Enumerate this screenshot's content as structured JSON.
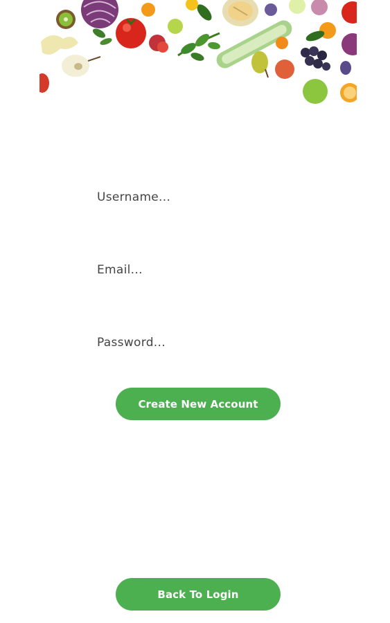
{
  "form": {
    "username_placeholder": "Username...",
    "email_placeholder": "Email...",
    "password_placeholder": "Password...",
    "username_value": "",
    "email_value": "",
    "password_value": ""
  },
  "buttons": {
    "create_label": "Create New Account",
    "back_label": "Back To Login"
  },
  "colors": {
    "accent": "#4caf50",
    "button_text": "#ffffff",
    "placeholder_text": "#444444",
    "background": "#ffffff"
  },
  "header": {
    "image": "vegetables-fruits-banner"
  }
}
